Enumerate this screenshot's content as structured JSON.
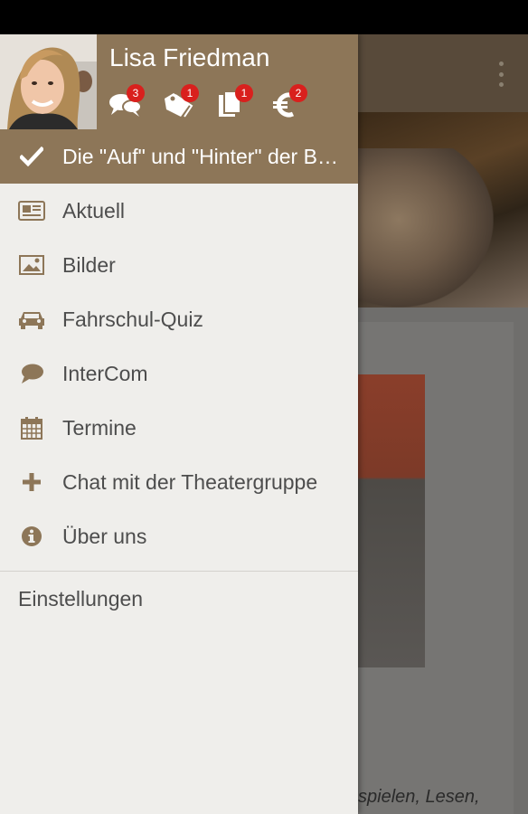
{
  "user": {
    "name": "Lisa Friedman",
    "badges": [
      {
        "icon": "chat-bubbles-icon",
        "count": "3"
      },
      {
        "icon": "tags-icon",
        "count": "1"
      },
      {
        "icon": "pages-icon",
        "count": "1"
      },
      {
        "icon": "euro-icon",
        "count": "2"
      }
    ]
  },
  "menu": {
    "items": [
      {
        "label": "Die \"Auf\" und \"Hinter\" der Bühne",
        "icon": "checkmark-icon",
        "active": true
      },
      {
        "label": "Aktuell",
        "icon": "newspaper-icon"
      },
      {
        "label": "Bilder",
        "icon": "image-icon"
      },
      {
        "label": "Fahrschul-Quiz",
        "icon": "car-icon"
      },
      {
        "label": "InterCom",
        "icon": "speech-bubble-icon"
      },
      {
        "label": "Termine",
        "icon": "calendar-icon"
      },
      {
        "label": "Chat mit der Theatergruppe",
        "icon": "plus-icon"
      },
      {
        "label": "Über uns",
        "icon": "info-icon"
      }
    ],
    "settings_label": "Einstellungen"
  },
  "background": {
    "snippet": "spielen, Lesen,"
  },
  "colors": {
    "brand": "#8d7658",
    "badge": "#d9201d",
    "drawer_bg": "#efeeeb",
    "text": "#4d4d4d"
  }
}
